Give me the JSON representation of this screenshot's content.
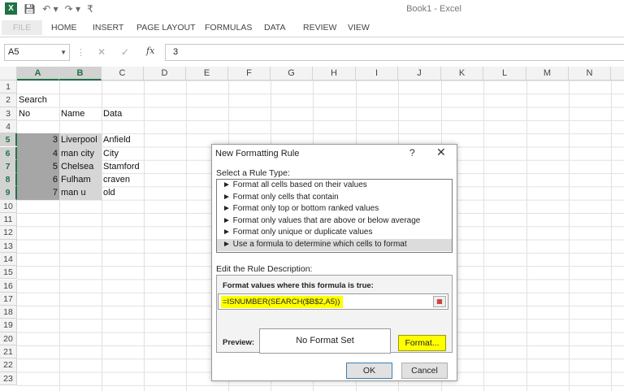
{
  "window": {
    "title": "Book1 - Excel",
    "app_icon_label": "X"
  },
  "ribbon": {
    "tabs": [
      "FILE",
      "HOME",
      "INSERT",
      "PAGE LAYOUT",
      "FORMULAS",
      "DATA",
      "REVIEW",
      "VIEW"
    ]
  },
  "formula_bar": {
    "name_box": "A5",
    "fx_label": "fx",
    "value": "3"
  },
  "columns": [
    "A",
    "B",
    "C",
    "D",
    "E",
    "F",
    "G",
    "H",
    "I",
    "J",
    "K",
    "L",
    "M",
    "N"
  ],
  "rows": [
    "1",
    "2",
    "3",
    "4",
    "5",
    "6",
    "7",
    "8",
    "9",
    "10",
    "11",
    "12",
    "13",
    "14",
    "15",
    "16",
    "17",
    "18",
    "19",
    "20",
    "21",
    "22",
    "23"
  ],
  "sheet": {
    "a2": "Search",
    "headers": {
      "a3": "No",
      "b3": "Name",
      "c3": "Data"
    },
    "data": [
      {
        "no": "3",
        "name": "Liverpool",
        "data": "Anfield"
      },
      {
        "no": "4",
        "name": "man city",
        "data": "City"
      },
      {
        "no": "5",
        "name": "Chelsea",
        "data": "Stamford"
      },
      {
        "no": "6",
        "name": "Fulham",
        "data": "craven"
      },
      {
        "no": "7",
        "name": "man u",
        "data": "old"
      }
    ]
  },
  "dialog": {
    "title": "New Formatting Rule",
    "help": "?",
    "close": "✕",
    "select_type_label": "Select a Rule Type:",
    "rule_types": [
      "► Format all cells based on their values",
      "► Format only cells that contain",
      "► Format only top or bottom ranked values",
      "► Format only values that are above or below average",
      "► Format only unique or duplicate values",
      "► Use a formula to determine which cells to format"
    ],
    "edit_label": "Edit the Rule Description:",
    "formula_label": "Format values where this formula is true:",
    "formula_value": "=ISNUMBER(SEARCH($B$2,A5))",
    "preview_label": "Preview:",
    "preview_text": "No Format Set",
    "format_button": "Format...",
    "ok_button": "OK",
    "cancel_button": "Cancel"
  }
}
